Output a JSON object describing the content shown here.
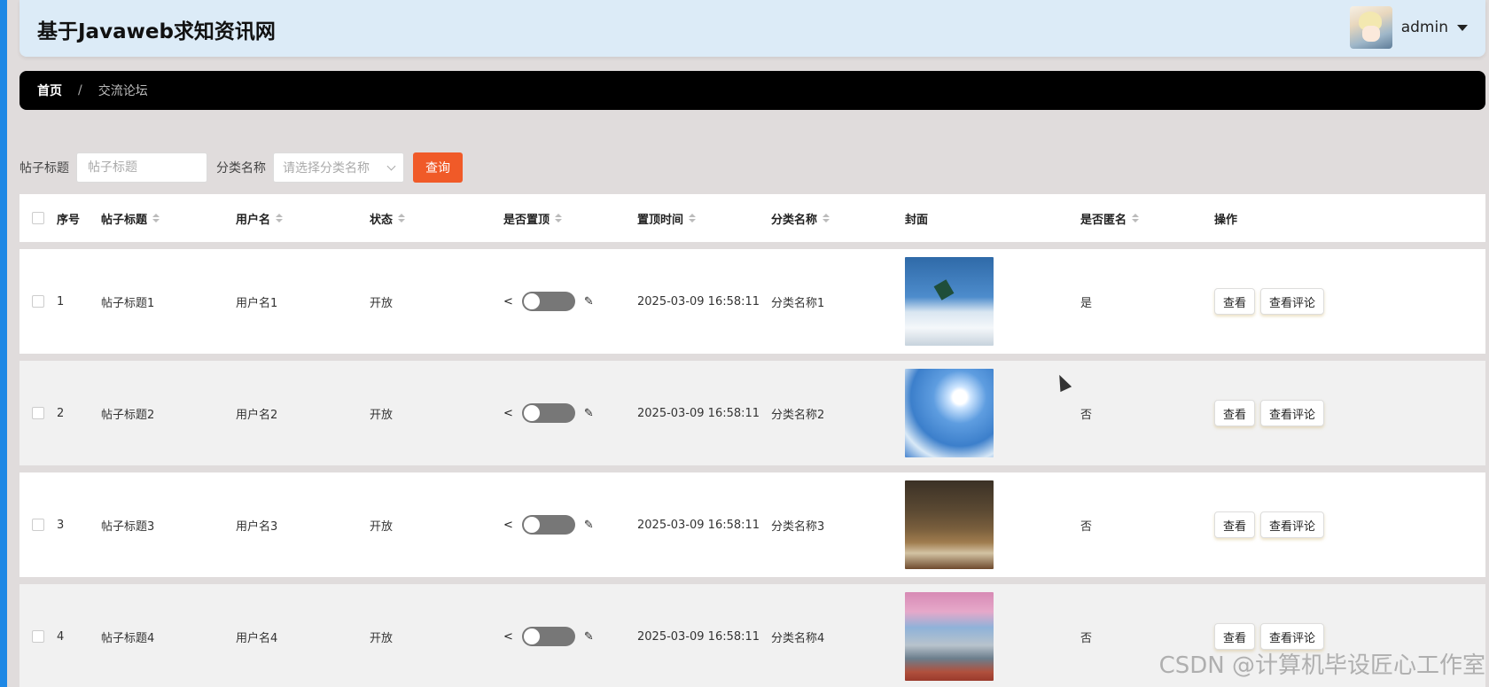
{
  "app": {
    "title": "基于Javaweb求知资讯网",
    "user_name": "admin"
  },
  "breadcrumb": {
    "home": "首页",
    "separator": "/",
    "current": "交流论坛"
  },
  "search": {
    "title_label": "帖子标题",
    "title_placeholder": "帖子标题",
    "category_label": "分类名称",
    "category_placeholder": "请选择分类名称",
    "query_button": "查询"
  },
  "table": {
    "headers": {
      "index": "序号",
      "title": "帖子标题",
      "user": "用户名",
      "status": "状态",
      "pinned": "是否置顶",
      "pinned_time": "置顶时间",
      "category": "分类名称",
      "cover": "封面",
      "anonymous": "是否匿名",
      "ops": "操作"
    },
    "rows": [
      {
        "index": "1",
        "title": "帖子标题1",
        "user": "用户名1",
        "status": "开放",
        "pinned_time": "2025-03-09 16:58:11",
        "category": "分类名称1",
        "anonymous": "是",
        "view": "查看",
        "view_comments": "查看评论"
      },
      {
        "index": "2",
        "title": "帖子标题2",
        "user": "用户名2",
        "status": "开放",
        "pinned_time": "2025-03-09 16:58:11",
        "category": "分类名称2",
        "anonymous": "否",
        "view": "查看",
        "view_comments": "查看评论"
      },
      {
        "index": "3",
        "title": "帖子标题3",
        "user": "用户名3",
        "status": "开放",
        "pinned_time": "2025-03-09 16:58:11",
        "category": "分类名称3",
        "anonymous": "否",
        "view": "查看",
        "view_comments": "查看评论"
      },
      {
        "index": "4",
        "title": "帖子标题4",
        "user": "用户名4",
        "status": "开放",
        "pinned_time": "2025-03-09 16:58:11",
        "category": "分类名称4",
        "anonymous": "否",
        "view": "查看",
        "view_comments": "查看评论"
      }
    ]
  },
  "watermark": "CSDN @计算机毕设匠心工作室",
  "colors": {
    "accent_strip": "#1e88e5",
    "query_button": "#f05a28",
    "topbar": "#dcebf7",
    "breadcrumb_bg": "#000000"
  }
}
